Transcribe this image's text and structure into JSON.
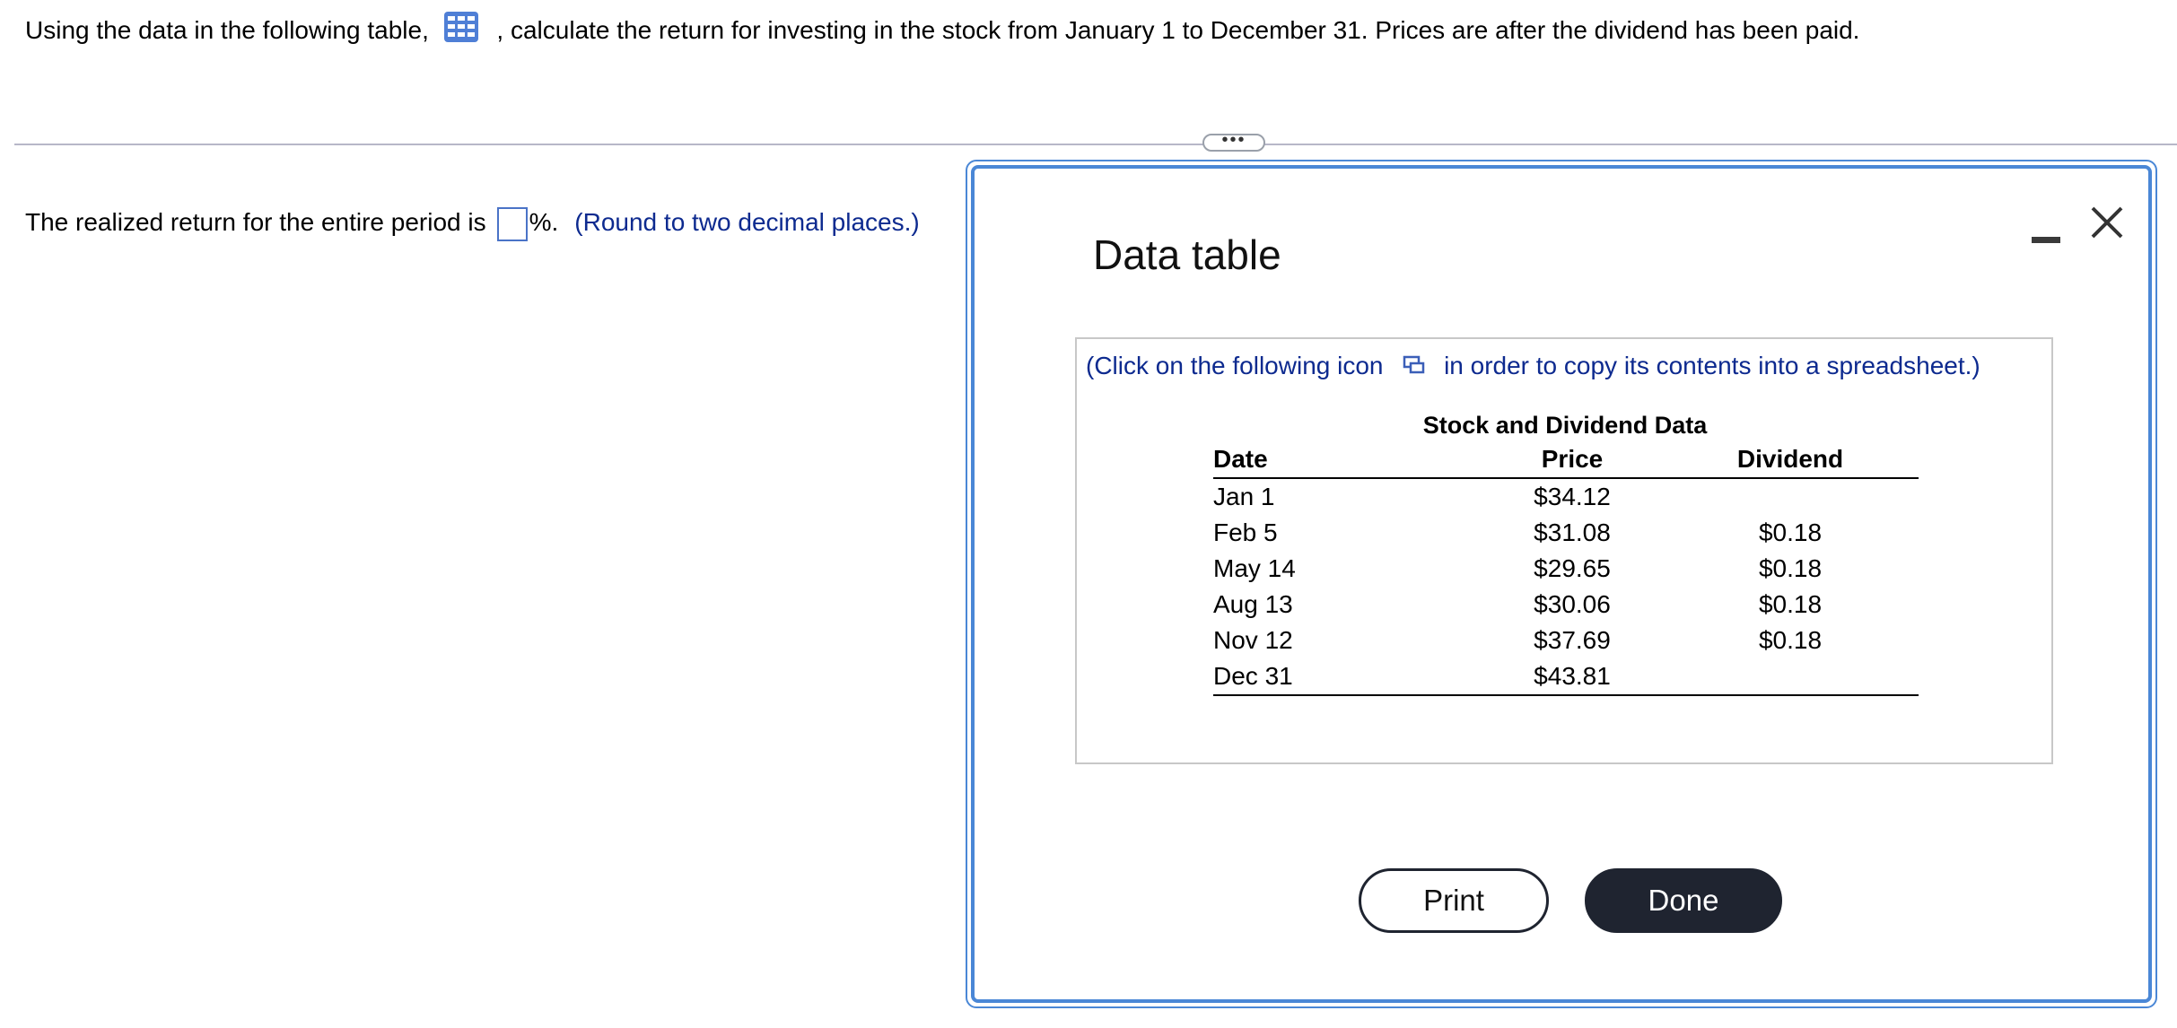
{
  "question": {
    "before_icon": "Using the data in the following table,",
    "icon": "table-grid-icon",
    "after_icon": ", calculate the return for investing in the stock from January 1 to December 31. Prices are after the dividend has been paid."
  },
  "expander": {
    "label": "•••"
  },
  "answer": {
    "prefix": "The realized return for the entire period is",
    "suffix": "%.",
    "hint": "(Round to two decimal places.)",
    "value": ""
  },
  "modal": {
    "title": "Data table",
    "copy_note_before": "(Click on the following icon",
    "copy_note_after": "in order to copy its contents into a spreadsheet.)",
    "table_caption": "Stock and Dividend Data",
    "columns": [
      "Date",
      "Price",
      "Dividend"
    ],
    "rows": [
      {
        "date": "Jan 1",
        "price": "$34.12",
        "dividend": ""
      },
      {
        "date": "Feb 5",
        "price": "$31.08",
        "dividend": "$0.18"
      },
      {
        "date": "May 14",
        "price": "$29.65",
        "dividend": "$0.18"
      },
      {
        "date": "Aug 13",
        "price": "$30.06",
        "dividend": "$0.18"
      },
      {
        "date": "Nov 12",
        "price": "$37.69",
        "dividend": "$0.18"
      },
      {
        "date": "Dec 31",
        "price": "$43.81",
        "dividend": ""
      }
    ],
    "print_label": "Print",
    "done_label": "Done",
    "accent_color": "#4a87d6"
  }
}
